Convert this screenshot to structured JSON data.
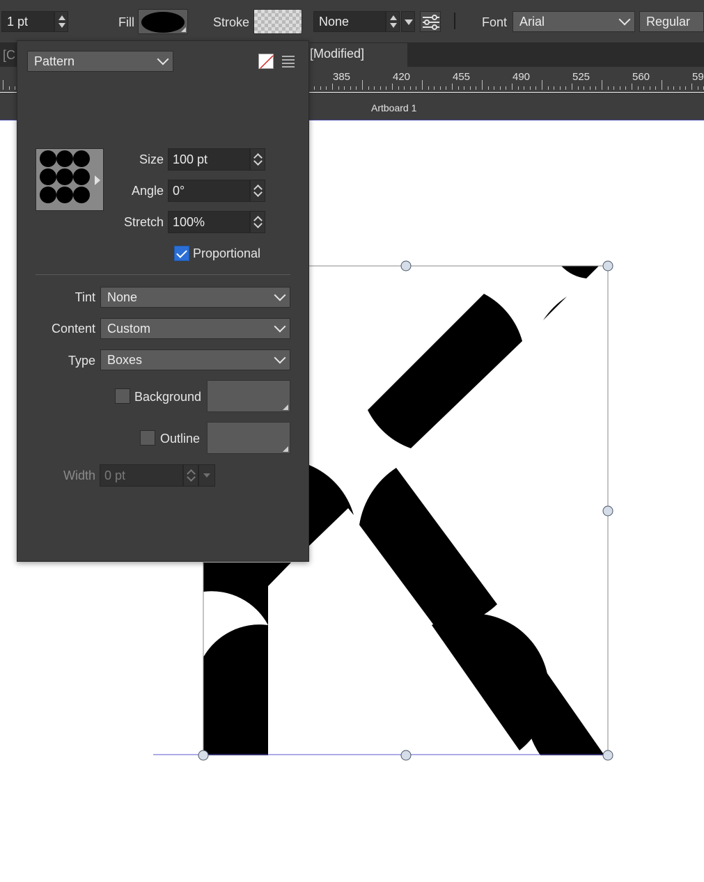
{
  "toolbar": {
    "stroke_width": "1 pt",
    "fill_label": "Fill",
    "stroke_label": "Stroke",
    "style_value": "None",
    "font_label": "Font",
    "font_family": "Arial",
    "font_style": "Regular",
    "fill_color": "#000000"
  },
  "document": {
    "tab_left_fragment": "[C",
    "tab_title": "[Modified]",
    "artboard_title": "Artboard 1"
  },
  "ruler": {
    "labels": [
      "385",
      "420",
      "455",
      "490",
      "525",
      "560",
      "59"
    ]
  },
  "panel": {
    "mode": "Pattern",
    "size_label": "Size",
    "size_value": "100 pt",
    "angle_label": "Angle",
    "angle_value": "0°",
    "stretch_label": "Stretch",
    "stretch_value": "100%",
    "proportional_label": "Proportional",
    "proportional_checked": true,
    "tint_label": "Tint",
    "tint_value": "None",
    "content_label": "Content",
    "content_value": "Custom",
    "type_label": "Type",
    "type_value": "Boxes",
    "background_label": "Background",
    "outline_label": "Outline",
    "width_label": "Width",
    "width_value": "0 pt"
  },
  "colors": {
    "accent": "#2b6fd6",
    "selection": "#4a4aa8",
    "panel_bg": "#3d3d3d"
  }
}
